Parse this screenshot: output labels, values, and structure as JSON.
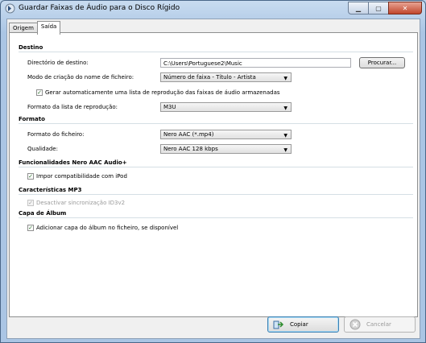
{
  "window": {
    "title": "Guardar Faixas de Áudio para o Disco Rígido"
  },
  "tabs": [
    {
      "label": "Origem"
    },
    {
      "label": "Saída"
    }
  ],
  "destino": {
    "heading": "Destino",
    "dir_label": "Directório de destino:",
    "dir_value": "C:\\Users\\Portuguese2\\Music",
    "browse_label": "Procurar...",
    "mode_label": "Modo de criação do nome de ficheiro:",
    "mode_value": "Número de faixa - Título - Artista",
    "playlist_check_label": "Gerar automaticamente uma lista de reprodução das faixas de áudio armazenadas",
    "playlist_format_label": "Formato da lista de reprodução:",
    "playlist_format_value": "M3U"
  },
  "formato": {
    "heading": "Formato",
    "file_format_label": "Formato do ficheiro:",
    "file_format_value": "Nero AAC (*.mp4)",
    "quality_label": "Qualidade:",
    "quality_value": "Nero AAC 128 kbps"
  },
  "nero_aac": {
    "heading": "Funcionalidades Nero AAC Audio+",
    "ipod_label": "Impor compatibilidade com iPod"
  },
  "mp3": {
    "heading": "Características MP3",
    "id3_label": "Desactivar sincronização ID3v2"
  },
  "album": {
    "heading": "Capa de Álbum",
    "cover_label": "Adicionar capa do álbum no ficheiro, se disponível"
  },
  "footer": {
    "copy_label": "Copiar",
    "cancel_label": "Cancelar"
  }
}
